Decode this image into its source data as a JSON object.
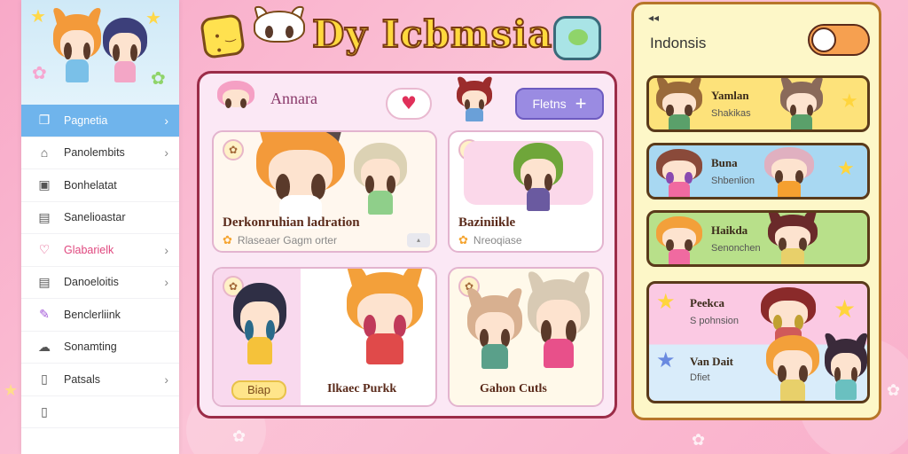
{
  "app": {
    "title": "Dy Icbmsia"
  },
  "sidebar": {
    "items": [
      {
        "label": "Pagnetia",
        "icon": "chat-icon",
        "chevron": "›",
        "active": true
      },
      {
        "label": "Panolembits",
        "icon": "home-icon",
        "chevron": "›"
      },
      {
        "label": "Bonhelatat",
        "icon": "window-icon",
        "chevron": ""
      },
      {
        "label": "Sanelioastar",
        "icon": "document-icon",
        "chevron": ""
      },
      {
        "label": "Glabarielk",
        "icon": "heart-icon",
        "chevron": "›"
      },
      {
        "label": "Danoeloitis",
        "icon": "list-icon",
        "chevron": "›"
      },
      {
        "label": "Benclerliink",
        "icon": "pencil-icon",
        "chevron": ""
      },
      {
        "label": "Sonamting",
        "icon": "cloud-icon",
        "chevron": ""
      },
      {
        "label": "Patsals",
        "icon": "page-icon",
        "chevron": "›"
      },
      {
        "label": "",
        "icon": "doc-icon",
        "chevron": ""
      }
    ]
  },
  "main": {
    "label": "Annara",
    "add_button": {
      "label": "Fletns",
      "icon": "plus"
    },
    "cards": [
      {
        "title": "Derkonruhian ladration",
        "subtitle": "Rlaseaer Gagm orter"
      },
      {
        "title": "Baziniikle",
        "subtitle": "Nreoqiase"
      },
      {
        "title": "",
        "subtitle": "",
        "button": "Biap"
      },
      {
        "title": "Ilkaec Purkk",
        "subtitle": ""
      },
      {
        "title": "Gahon Cutls",
        "subtitle": ""
      }
    ]
  },
  "right": {
    "title": "Indonsis",
    "top_icon": "◂◂",
    "cards": [
      {
        "name": "Yamlan",
        "sub": "Shakikas",
        "bg": "#fde27a"
      },
      {
        "name": "Buna",
        "sub": "Shbenlion",
        "bg": "#a8d8f2"
      },
      {
        "name": "Haikda",
        "sub": "Senonchen",
        "bg": "#b8e08a"
      },
      {
        "name": "Peekca",
        "sub": "S pohnsion"
      },
      {
        "name": "Van Dait",
        "sub": "Dfiet"
      }
    ]
  },
  "colors": {
    "background": "#f9b6cd",
    "accent_blue": "#6fb4ec",
    "title_yellow": "#ffd93d",
    "main_border": "#9b2c48",
    "add_button": "#9a8be2"
  }
}
